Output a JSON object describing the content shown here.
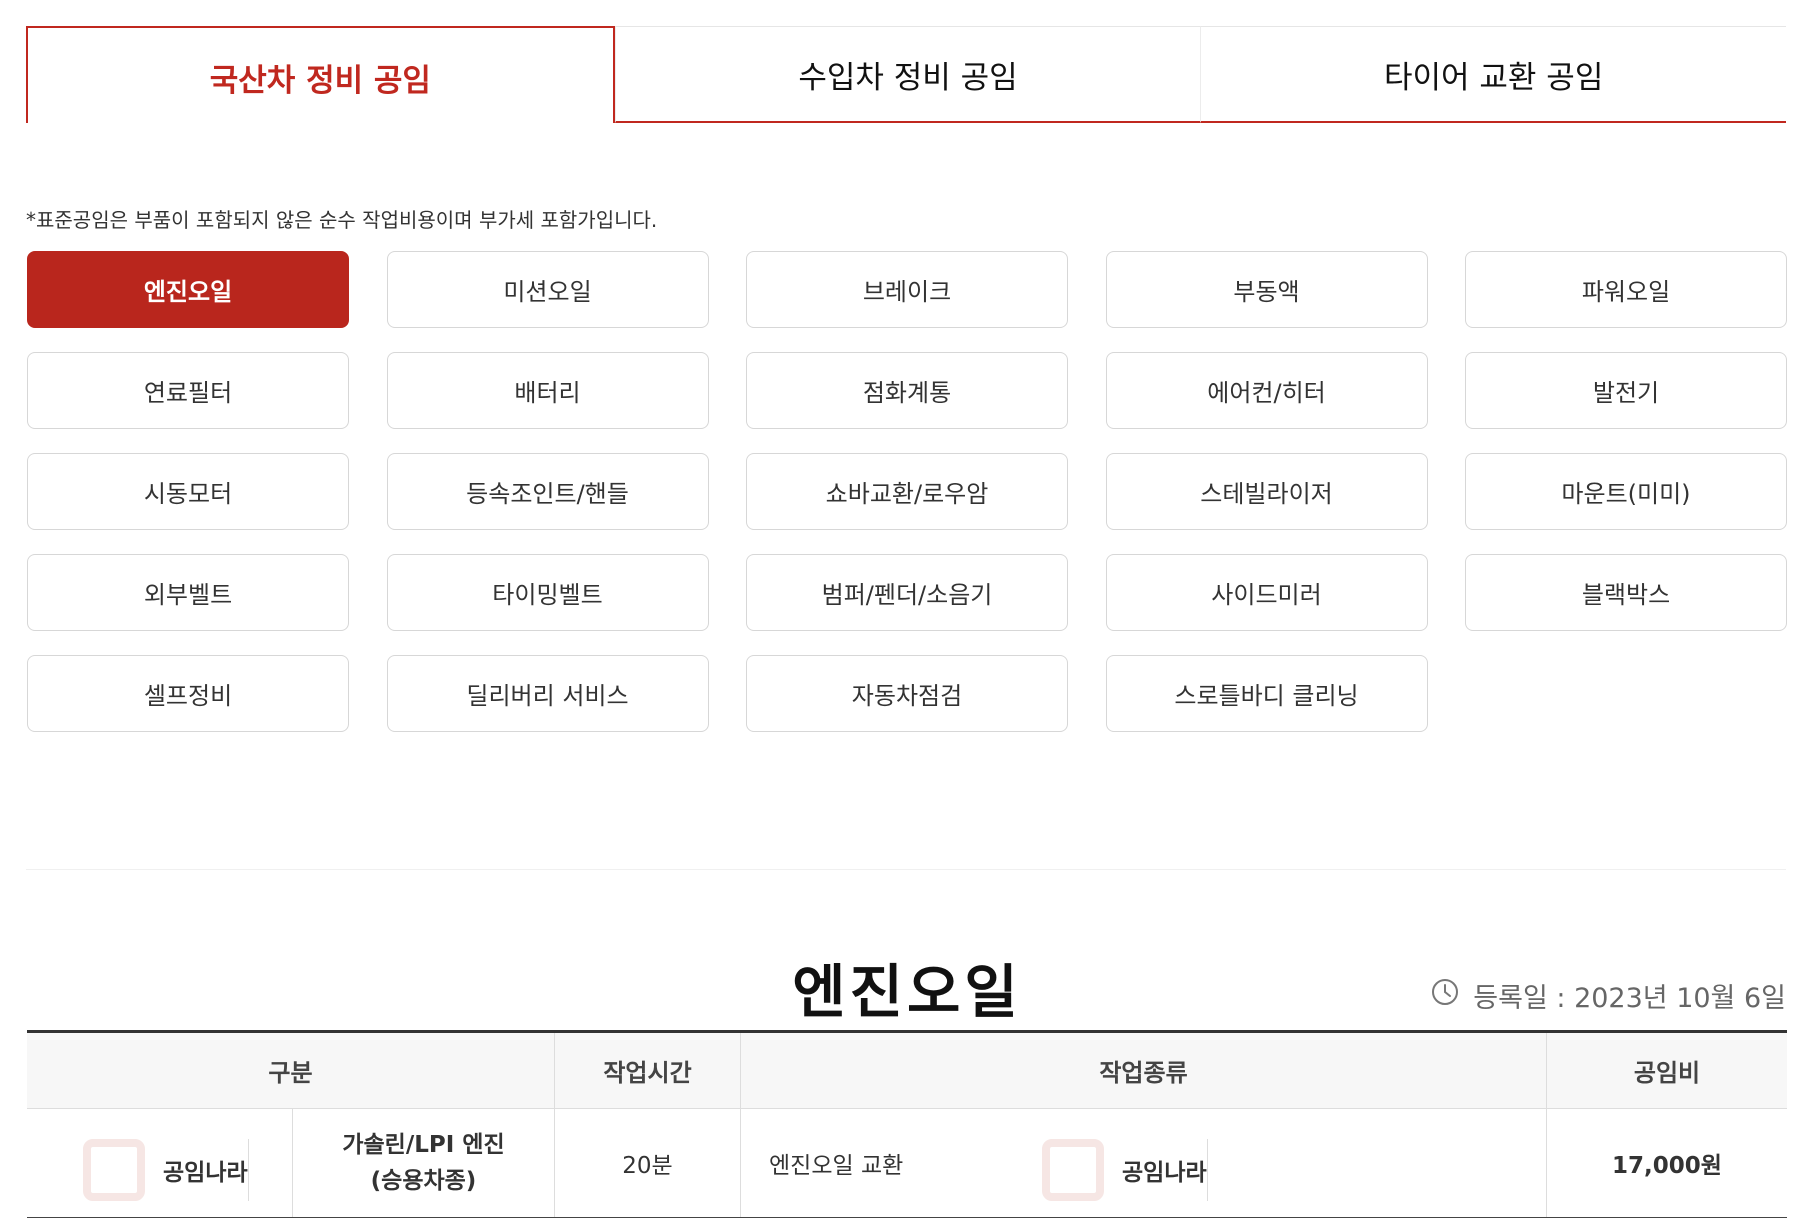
{
  "tabs": [
    {
      "label": "국산차 정비 공임",
      "active": true
    },
    {
      "label": "수입차 정비 공임",
      "active": false
    },
    {
      "label": "타이어 교환 공임",
      "active": false
    }
  ],
  "notice": "*표준공임은 부품이 포함되지 않은 순수 작업비용이며 부가세 포함가입니다.",
  "categories": [
    "엔진오일",
    "미션오일",
    "브레이크",
    "부동액",
    "파워오일",
    "연료필터",
    "배터리",
    "점화계통",
    "에어컨/히터",
    "발전기",
    "시동모터",
    "등속조인트/핸들",
    "쇼바교환/로우암",
    "스테빌라이저",
    "마운트(미미)",
    "외부벨트",
    "타이밍벨트",
    "범퍼/펜더/소음기",
    "사이드미러",
    "블랙박스",
    "셀프정비",
    "딜리버리 서비스",
    "자동차점검",
    "스로틀바디 클리닝"
  ],
  "active_category": "엔진오일",
  "section": {
    "title": "엔진오일",
    "reg_date": "등록일 : 2023년 10월 6일"
  },
  "table": {
    "headers": [
      "구분",
      "작업시간",
      "작업종류",
      "공임비"
    ],
    "rows": [
      {
        "category": "가솔린/LPI 엔진\n(승용차종)",
        "time": "20분",
        "work": "엔진오일 교환",
        "price": "17,000원"
      }
    ]
  },
  "watermark": "공임나라",
  "colors": {
    "accent": "#b9261d",
    "tab_active_text": "#c0281f"
  }
}
